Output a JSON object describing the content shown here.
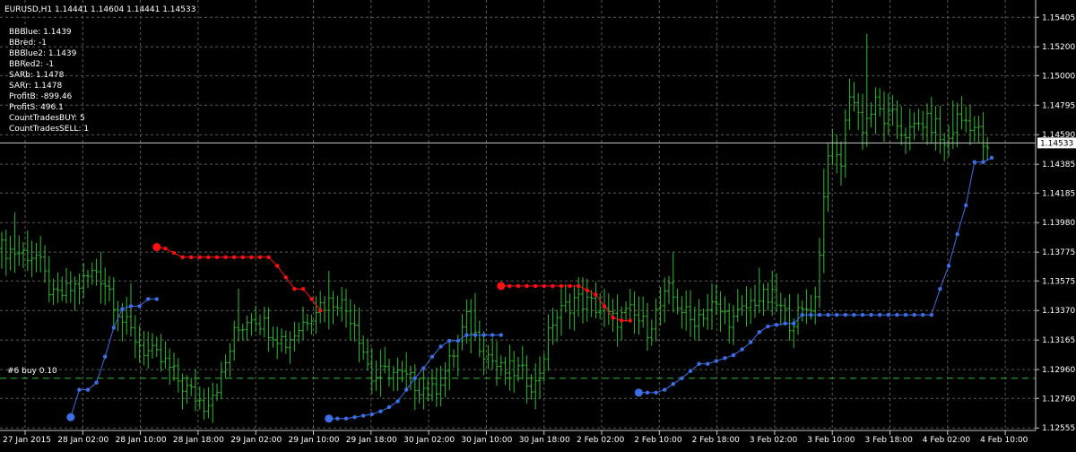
{
  "header": {
    "symbol_line": "EURUSD,H1  1.14441 1.14604 1.14441 1.14533"
  },
  "indicators": [
    "BBBlue: 1.1439",
    "BBred: -1",
    "BBBlue2: 1.1439",
    "BBRed2: -1",
    "SARb: 1.1478",
    "SARr: 1.1478",
    "ProfitB: -899.46",
    "ProfitS: 496.1",
    "CountTradesBUY: 5",
    "CountTradesSELL: 1"
  ],
  "order_label": "#6 buy 0.10",
  "current_price_label": "1.14533",
  "colors": {
    "background": "#000000",
    "bars": "#2fbe2f",
    "sar_buy": "#3c6ee6",
    "sar_sell": "#ff1010",
    "grid": "#5a5a5a",
    "order_line": "#2fbe2f"
  },
  "chart_data": {
    "type": "ohlc",
    "ylim": [
      1.1255,
      1.155
    ],
    "y_ticks": [
      "1.15405",
      "1.15200",
      "1.15000",
      "1.14795",
      "1.14590",
      "1.14385",
      "1.14185",
      "1.13980",
      "1.13775",
      "1.13575",
      "1.13370",
      "1.13165",
      "1.12960",
      "1.12760",
      "1.12555"
    ],
    "x_ticks": [
      "27 Jan 2015",
      "28 Jan 02:00",
      "28 Jan 10:00",
      "28 Jan 18:00",
      "29 Jan 02:00",
      "29 Jan 10:00",
      "29 Jan 18:00",
      "30 Jan 02:00",
      "30 Jan 10:00",
      "30 Jan 18:00",
      "2 Feb 02:00",
      "2 Feb 10:00",
      "2 Feb 18:00",
      "3 Feb 02:00",
      "3 Feb 10:00",
      "3 Feb 18:00",
      "4 Feb 02:00",
      "4 Feb 10:00"
    ],
    "current_price": 1.14533,
    "order_price": 1.129,
    "bar_keypoints": [
      [
        0,
        1.138
      ],
      [
        8,
        1.1375
      ],
      [
        12,
        1.1345
      ],
      [
        18,
        1.1355
      ],
      [
        22,
        1.1365
      ],
      [
        25,
        1.1352
      ],
      [
        28,
        1.133
      ],
      [
        33,
        1.131
      ],
      [
        38,
        1.13
      ],
      [
        42,
        1.1285
      ],
      [
        47,
        1.1272
      ],
      [
        51,
        1.129
      ],
      [
        54,
        1.132
      ],
      [
        58,
        1.1335
      ],
      [
        62,
        1.1325
      ],
      [
        66,
        1.1315
      ],
      [
        69,
        1.1325
      ],
      [
        73,
        1.134
      ],
      [
        78,
        1.1345
      ],
      [
        82,
        1.133
      ],
      [
        86,
        1.129
      ],
      [
        90,
        1.1295
      ],
      [
        95,
        1.1288
      ],
      [
        100,
        1.128
      ],
      [
        104,
        1.13
      ],
      [
        108,
        1.133
      ],
      [
        112,
        1.131
      ],
      [
        116,
        1.1295
      ],
      [
        120,
        1.1295
      ],
      [
        124,
        1.1285
      ],
      [
        128,
        1.133
      ],
      [
        133,
        1.1345
      ],
      [
        138,
        1.134
      ],
      [
        142,
        1.133
      ],
      [
        146,
        1.1335
      ],
      [
        150,
        1.1325
      ],
      [
        155,
        1.135
      ],
      [
        160,
        1.133
      ],
      [
        165,
        1.134
      ],
      [
        170,
        1.133
      ],
      [
        175,
        1.1345
      ],
      [
        179,
        1.1345
      ],
      [
        183,
        1.133
      ],
      [
        186,
        1.1335
      ],
      [
        189,
        1.1345
      ],
      [
        192,
        1.145
      ],
      [
        195,
        1.144
      ],
      [
        197,
        1.149
      ],
      [
        200,
        1.1465
      ],
      [
        203,
        1.148
      ],
      [
        205,
        1.147
      ],
      [
        207,
        1.147
      ],
      [
        209,
        1.1462
      ],
      [
        211,
        1.146
      ],
      [
        214,
        1.1468
      ],
      [
        217,
        1.1465
      ],
      [
        219,
        1.145
      ],
      [
        222,
        1.147
      ],
      [
        225,
        1.1468
      ],
      [
        227,
        1.146
      ],
      [
        229,
        1.1445
      ]
    ],
    "bar_spikes": [
      [
        3,
        0.0012
      ],
      [
        30,
        0.001
      ],
      [
        55,
        0.0015
      ],
      [
        76,
        0.0012
      ],
      [
        110,
        0.0014
      ],
      [
        156,
        0.0012
      ],
      [
        176,
        0.0011
      ],
      [
        191,
        0.0014
      ],
      [
        201,
        0.0045
      ],
      [
        221,
        0.001
      ]
    ],
    "sar_buy": [
      [
        [
          16,
          1.1263
        ],
        [
          18,
          1.1282
        ],
        [
          20,
          1.1282
        ],
        [
          22,
          1.1287
        ],
        [
          24,
          1.1305
        ],
        [
          26,
          1.1325
        ],
        [
          28,
          1.1338
        ],
        [
          30,
          1.134
        ],
        [
          32,
          1.134
        ],
        [
          34,
          1.1345
        ],
        [
          36,
          1.1345
        ]
      ],
      [
        [
          76,
          1.1262
        ],
        [
          78,
          1.1262
        ],
        [
          80,
          1.1262
        ],
        [
          82,
          1.1263
        ],
        [
          84,
          1.1264
        ],
        [
          86,
          1.1265
        ],
        [
          88,
          1.1267
        ],
        [
          90,
          1.127
        ],
        [
          92,
          1.1274
        ],
        [
          94,
          1.1282
        ],
        [
          96,
          1.129
        ],
        [
          98,
          1.1297
        ],
        [
          100,
          1.1305
        ],
        [
          102,
          1.1312
        ],
        [
          104,
          1.1316
        ],
        [
          106,
          1.1316
        ],
        [
          108,
          1.132
        ],
        [
          110,
          1.132
        ],
        [
          112,
          1.132
        ],
        [
          114,
          1.132
        ],
        [
          116,
          1.132
        ]
      ],
      [
        [
          148,
          1.128
        ],
        [
          150,
          1.128
        ],
        [
          152,
          1.128
        ],
        [
          154,
          1.1282
        ],
        [
          156,
          1.1286
        ],
        [
          158,
          1.129
        ],
        [
          160,
          1.1295
        ],
        [
          162,
          1.13
        ],
        [
          164,
          1.13
        ],
        [
          166,
          1.1302
        ],
        [
          168,
          1.1304
        ],
        [
          170,
          1.1306
        ],
        [
          172,
          1.131
        ],
        [
          174,
          1.1315
        ],
        [
          176,
          1.1322
        ],
        [
          178,
          1.1326
        ],
        [
          180,
          1.1327
        ],
        [
          182,
          1.1328
        ],
        [
          184,
          1.1328
        ],
        [
          186,
          1.1334
        ],
        [
          188,
          1.1334
        ],
        [
          190,
          1.1334
        ],
        [
          192,
          1.1334
        ],
        [
          194,
          1.1334
        ],
        [
          196,
          1.1334
        ],
        [
          198,
          1.1334
        ],
        [
          200,
          1.1334
        ],
        [
          202,
          1.1334
        ],
        [
          204,
          1.1334
        ],
        [
          206,
          1.1334
        ],
        [
          208,
          1.1334
        ],
        [
          210,
          1.1334
        ],
        [
          212,
          1.1334
        ],
        [
          214,
          1.1334
        ],
        [
          216,
          1.1334
        ],
        [
          218,
          1.1352
        ],
        [
          220,
          1.1368
        ],
        [
          222,
          1.139
        ],
        [
          224,
          1.141
        ],
        [
          226,
          1.144
        ],
        [
          228,
          1.144
        ],
        [
          230,
          1.1443
        ]
      ]
    ],
    "sar_sell": [
      [
        [
          36,
          1.1381
        ],
        [
          38,
          1.138
        ],
        [
          40,
          1.1377
        ],
        [
          42,
          1.1374
        ],
        [
          44,
          1.1374
        ],
        [
          46,
          1.1374
        ],
        [
          48,
          1.1374
        ],
        [
          50,
          1.1374
        ],
        [
          52,
          1.1374
        ],
        [
          54,
          1.1374
        ],
        [
          56,
          1.1374
        ],
        [
          58,
          1.1374
        ],
        [
          60,
          1.1374
        ],
        [
          62,
          1.1374
        ],
        [
          64,
          1.1368
        ],
        [
          66,
          1.136
        ],
        [
          68,
          1.1352
        ],
        [
          70,
          1.1352
        ],
        [
          72,
          1.1345
        ],
        [
          74,
          1.1337
        ]
      ],
      [
        [
          116,
          1.1354
        ],
        [
          118,
          1.1354
        ],
        [
          120,
          1.1354
        ],
        [
          122,
          1.1354
        ],
        [
          124,
          1.1354
        ],
        [
          126,
          1.1354
        ],
        [
          128,
          1.1354
        ],
        [
          130,
          1.1354
        ],
        [
          132,
          1.1354
        ],
        [
          134,
          1.1354
        ],
        [
          136,
          1.1351
        ],
        [
          138,
          1.1348
        ],
        [
          140,
          1.134
        ],
        [
          142,
          1.1332
        ],
        [
          144,
          1.133
        ],
        [
          146,
          1.133
        ]
      ]
    ]
  }
}
